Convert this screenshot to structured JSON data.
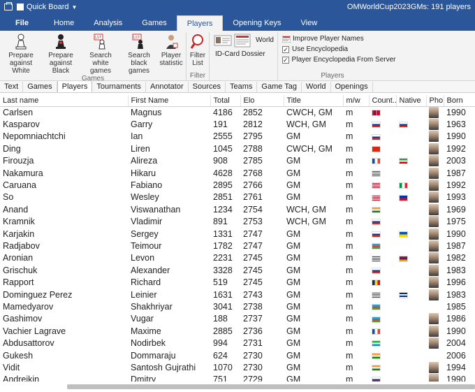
{
  "titlebar": {
    "quick_board": "Quick Board",
    "database_info": "OMWorldCup2023GMs:  191 players"
  },
  "ribbon_tabs": [
    "File",
    "Home",
    "Analysis",
    "Games",
    "Players",
    "Opening Keys",
    "View"
  ],
  "ribbon": {
    "games_group": {
      "label": "Games",
      "buttons": [
        {
          "line1": "Prepare",
          "line2": "against White",
          "icon": "white-pawn-icon"
        },
        {
          "line1": "Prepare",
          "line2": "against Black",
          "icon": "black-pawn-icon"
        },
        {
          "line1": "Search",
          "line2": "white games",
          "icon": "list-white-icon"
        },
        {
          "line1": "Search",
          "line2": "black games",
          "icon": "list-black-icon"
        },
        {
          "line1": "Player",
          "line2": "statistic",
          "icon": "statistic-icon"
        }
      ]
    },
    "filter_group": {
      "label": "Filter",
      "buttons": [
        {
          "line1": "Filter",
          "line2": "List",
          "icon": "magnifier-icon"
        }
      ]
    },
    "dossier": {
      "id_card": "ID-Card Dossier",
      "world": "World"
    },
    "players_group": {
      "label": "Players",
      "items": [
        {
          "label": "Improve Player Names",
          "kind": "icon"
        },
        {
          "label": "Use Encyclopedia",
          "kind": "check",
          "checked": true
        },
        {
          "label": "Player Encyclopedia From Server",
          "kind": "check",
          "checked": true
        }
      ]
    }
  },
  "subtabs": [
    "Text",
    "Games",
    "Players",
    "Tournaments",
    "Annotator",
    "Sources",
    "Teams",
    "Game Tag",
    "World",
    "Openings"
  ],
  "table": {
    "columns": [
      "Last name",
      "First Name",
      "Total",
      "Elo",
      "Title",
      "m/w",
      "Count...",
      "Native",
      "Pho...",
      "Born"
    ],
    "rows": [
      {
        "last": "Carlsen",
        "first": "Magnus",
        "total": "4186",
        "elo": "2852",
        "title": "CWCH, GM",
        "mw": "m",
        "country": "NOR",
        "native": "",
        "born": "1990",
        "photo": true
      },
      {
        "last": "Kasparov",
        "first": "Garry",
        "total": "191",
        "elo": "2812",
        "title": "WCH, GM",
        "mw": "m",
        "country": "RUS",
        "native": "RUS",
        "born": "1963",
        "photo": true
      },
      {
        "last": "Nepomniachtchi",
        "first": "Ian",
        "total": "2555",
        "elo": "2795",
        "title": "GM",
        "mw": "m",
        "country": "RUS",
        "native": "",
        "born": "1990",
        "photo": true
      },
      {
        "last": "Ding",
        "first": "Liren",
        "total": "1045",
        "elo": "2788",
        "title": "CWCH, GM",
        "mw": "m",
        "country": "CHN",
        "native": "",
        "born": "1992",
        "photo": true
      },
      {
        "last": "Firouzja",
        "first": "Alireza",
        "total": "908",
        "elo": "2785",
        "title": "GM",
        "mw": "m",
        "country": "FRA",
        "native": "IRI",
        "born": "2003",
        "photo": true
      },
      {
        "last": "Nakamura",
        "first": "Hikaru",
        "total": "4628",
        "elo": "2768",
        "title": "GM",
        "mw": "m",
        "country": "USA",
        "native": "",
        "born": "1987",
        "photo": true
      },
      {
        "last": "Caruana",
        "first": "Fabiano",
        "total": "2895",
        "elo": "2766",
        "title": "GM",
        "mw": "m",
        "country": "USA",
        "native": "ITA",
        "born": "1992",
        "photo": true
      },
      {
        "last": "So",
        "first": "Wesley",
        "total": "2851",
        "elo": "2761",
        "title": "GM",
        "mw": "m",
        "country": "USA",
        "native": "PHI",
        "born": "1993",
        "photo": true
      },
      {
        "last": "Anand",
        "first": "Viswanathan",
        "total": "1234",
        "elo": "2754",
        "title": "WCH, GM",
        "mw": "m",
        "country": "IND",
        "native": "",
        "born": "1969",
        "photo": true
      },
      {
        "last": "Kramnik",
        "first": "Vladimir",
        "total": "891",
        "elo": "2753",
        "title": "WCH, GM",
        "mw": "m",
        "country": "RUS",
        "native": "",
        "born": "1975",
        "photo": true
      },
      {
        "last": "Karjakin",
        "first": "Sergey",
        "total": "1331",
        "elo": "2747",
        "title": "GM",
        "mw": "m",
        "country": "RUS",
        "native": "UKR",
        "born": "1990",
        "photo": true
      },
      {
        "last": "Radjabov",
        "first": "Teimour",
        "total": "1782",
        "elo": "2747",
        "title": "GM",
        "mw": "m",
        "country": "AZE",
        "native": "",
        "born": "1987",
        "photo": true
      },
      {
        "last": "Aronian",
        "first": "Levon",
        "total": "2231",
        "elo": "2745",
        "title": "GM",
        "mw": "m",
        "country": "USA",
        "native": "ARM",
        "born": "1982",
        "photo": true
      },
      {
        "last": "Grischuk",
        "first": "Alexander",
        "total": "3328",
        "elo": "2745",
        "title": "GM",
        "mw": "m",
        "country": "RUS",
        "native": "",
        "born": "1983",
        "photo": true
      },
      {
        "last": "Rapport",
        "first": "Richard",
        "total": "519",
        "elo": "2745",
        "title": "GM",
        "mw": "m",
        "country": "ROU",
        "native": "",
        "born": "1996",
        "photo": true
      },
      {
        "last": "Dominguez Perez",
        "first": "Leinier",
        "total": "1631",
        "elo": "2743",
        "title": "GM",
        "mw": "m",
        "country": "USA",
        "native": "CUB",
        "born": "1983",
        "photo": true
      },
      {
        "last": "Mamedyarov",
        "first": "Shakhriyar",
        "total": "3041",
        "elo": "2738",
        "title": "GM",
        "mw": "m",
        "country": "AZE",
        "native": "",
        "born": "1985",
        "photo": false
      },
      {
        "last": "Gashimov",
        "first": "Vugar",
        "total": "188",
        "elo": "2737",
        "title": "GM",
        "mw": "m",
        "country": "AZE",
        "native": "",
        "born": "1986",
        "photo": true
      },
      {
        "last": "Vachier Lagrave",
        "first": "Maxime",
        "total": "2885",
        "elo": "2736",
        "title": "GM",
        "mw": "m",
        "country": "FRA",
        "native": "",
        "born": "1990",
        "photo": true
      },
      {
        "last": "Abdusattorov",
        "first": "Nodirbek",
        "total": "994",
        "elo": "2731",
        "title": "GM",
        "mw": "m",
        "country": "UZB",
        "native": "",
        "born": "2004",
        "photo": true
      },
      {
        "last": "Gukesh",
        "first": "Dommaraju",
        "total": "624",
        "elo": "2730",
        "title": "GM",
        "mw": "m",
        "country": "IND",
        "native": "",
        "born": "2006",
        "photo": false
      },
      {
        "last": "Vidit",
        "first": "Santosh Gujrathi",
        "total": "1070",
        "elo": "2730",
        "title": "GM",
        "mw": "m",
        "country": "IND",
        "native": "",
        "born": "1994",
        "photo": true
      },
      {
        "last": "Andreikin",
        "first": "Dmitry",
        "total": "751",
        "elo": "2729",
        "title": "GM",
        "mw": "m",
        "country": "RUS",
        "native": "",
        "born": "1990",
        "photo": true
      }
    ]
  },
  "colors": {
    "ribbon_blue": "#2b579a",
    "ribbon_bg": "#f3f3f3"
  }
}
